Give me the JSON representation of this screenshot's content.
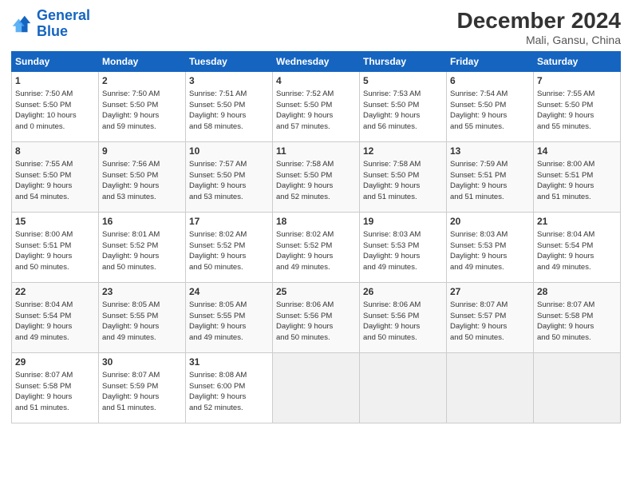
{
  "logo": {
    "line1": "General",
    "line2": "Blue"
  },
  "title": "December 2024",
  "subtitle": "Mali, Gansu, China",
  "days_header": [
    "Sunday",
    "Monday",
    "Tuesday",
    "Wednesday",
    "Thursday",
    "Friday",
    "Saturday"
  ],
  "weeks": [
    [
      {
        "num": "1",
        "info": "Sunrise: 7:50 AM\nSunset: 5:50 PM\nDaylight: 10 hours\nand 0 minutes."
      },
      {
        "num": "2",
        "info": "Sunrise: 7:50 AM\nSunset: 5:50 PM\nDaylight: 9 hours\nand 59 minutes."
      },
      {
        "num": "3",
        "info": "Sunrise: 7:51 AM\nSunset: 5:50 PM\nDaylight: 9 hours\nand 58 minutes."
      },
      {
        "num": "4",
        "info": "Sunrise: 7:52 AM\nSunset: 5:50 PM\nDaylight: 9 hours\nand 57 minutes."
      },
      {
        "num": "5",
        "info": "Sunrise: 7:53 AM\nSunset: 5:50 PM\nDaylight: 9 hours\nand 56 minutes."
      },
      {
        "num": "6",
        "info": "Sunrise: 7:54 AM\nSunset: 5:50 PM\nDaylight: 9 hours\nand 55 minutes."
      },
      {
        "num": "7",
        "info": "Sunrise: 7:55 AM\nSunset: 5:50 PM\nDaylight: 9 hours\nand 55 minutes."
      }
    ],
    [
      {
        "num": "8",
        "info": "Sunrise: 7:55 AM\nSunset: 5:50 PM\nDaylight: 9 hours\nand 54 minutes."
      },
      {
        "num": "9",
        "info": "Sunrise: 7:56 AM\nSunset: 5:50 PM\nDaylight: 9 hours\nand 53 minutes."
      },
      {
        "num": "10",
        "info": "Sunrise: 7:57 AM\nSunset: 5:50 PM\nDaylight: 9 hours\nand 53 minutes."
      },
      {
        "num": "11",
        "info": "Sunrise: 7:58 AM\nSunset: 5:50 PM\nDaylight: 9 hours\nand 52 minutes."
      },
      {
        "num": "12",
        "info": "Sunrise: 7:58 AM\nSunset: 5:50 PM\nDaylight: 9 hours\nand 51 minutes."
      },
      {
        "num": "13",
        "info": "Sunrise: 7:59 AM\nSunset: 5:51 PM\nDaylight: 9 hours\nand 51 minutes."
      },
      {
        "num": "14",
        "info": "Sunrise: 8:00 AM\nSunset: 5:51 PM\nDaylight: 9 hours\nand 51 minutes."
      }
    ],
    [
      {
        "num": "15",
        "info": "Sunrise: 8:00 AM\nSunset: 5:51 PM\nDaylight: 9 hours\nand 50 minutes."
      },
      {
        "num": "16",
        "info": "Sunrise: 8:01 AM\nSunset: 5:52 PM\nDaylight: 9 hours\nand 50 minutes."
      },
      {
        "num": "17",
        "info": "Sunrise: 8:02 AM\nSunset: 5:52 PM\nDaylight: 9 hours\nand 50 minutes."
      },
      {
        "num": "18",
        "info": "Sunrise: 8:02 AM\nSunset: 5:52 PM\nDaylight: 9 hours\nand 49 minutes."
      },
      {
        "num": "19",
        "info": "Sunrise: 8:03 AM\nSunset: 5:53 PM\nDaylight: 9 hours\nand 49 minutes."
      },
      {
        "num": "20",
        "info": "Sunrise: 8:03 AM\nSunset: 5:53 PM\nDaylight: 9 hours\nand 49 minutes."
      },
      {
        "num": "21",
        "info": "Sunrise: 8:04 AM\nSunset: 5:54 PM\nDaylight: 9 hours\nand 49 minutes."
      }
    ],
    [
      {
        "num": "22",
        "info": "Sunrise: 8:04 AM\nSunset: 5:54 PM\nDaylight: 9 hours\nand 49 minutes."
      },
      {
        "num": "23",
        "info": "Sunrise: 8:05 AM\nSunset: 5:55 PM\nDaylight: 9 hours\nand 49 minutes."
      },
      {
        "num": "24",
        "info": "Sunrise: 8:05 AM\nSunset: 5:55 PM\nDaylight: 9 hours\nand 49 minutes."
      },
      {
        "num": "25",
        "info": "Sunrise: 8:06 AM\nSunset: 5:56 PM\nDaylight: 9 hours\nand 50 minutes."
      },
      {
        "num": "26",
        "info": "Sunrise: 8:06 AM\nSunset: 5:56 PM\nDaylight: 9 hours\nand 50 minutes."
      },
      {
        "num": "27",
        "info": "Sunrise: 8:07 AM\nSunset: 5:57 PM\nDaylight: 9 hours\nand 50 minutes."
      },
      {
        "num": "28",
        "info": "Sunrise: 8:07 AM\nSunset: 5:58 PM\nDaylight: 9 hours\nand 50 minutes."
      }
    ],
    [
      {
        "num": "29",
        "info": "Sunrise: 8:07 AM\nSunset: 5:58 PM\nDaylight: 9 hours\nand 51 minutes."
      },
      {
        "num": "30",
        "info": "Sunrise: 8:07 AM\nSunset: 5:59 PM\nDaylight: 9 hours\nand 51 minutes."
      },
      {
        "num": "31",
        "info": "Sunrise: 8:08 AM\nSunset: 6:00 PM\nDaylight: 9 hours\nand 52 minutes."
      },
      null,
      null,
      null,
      null
    ]
  ]
}
